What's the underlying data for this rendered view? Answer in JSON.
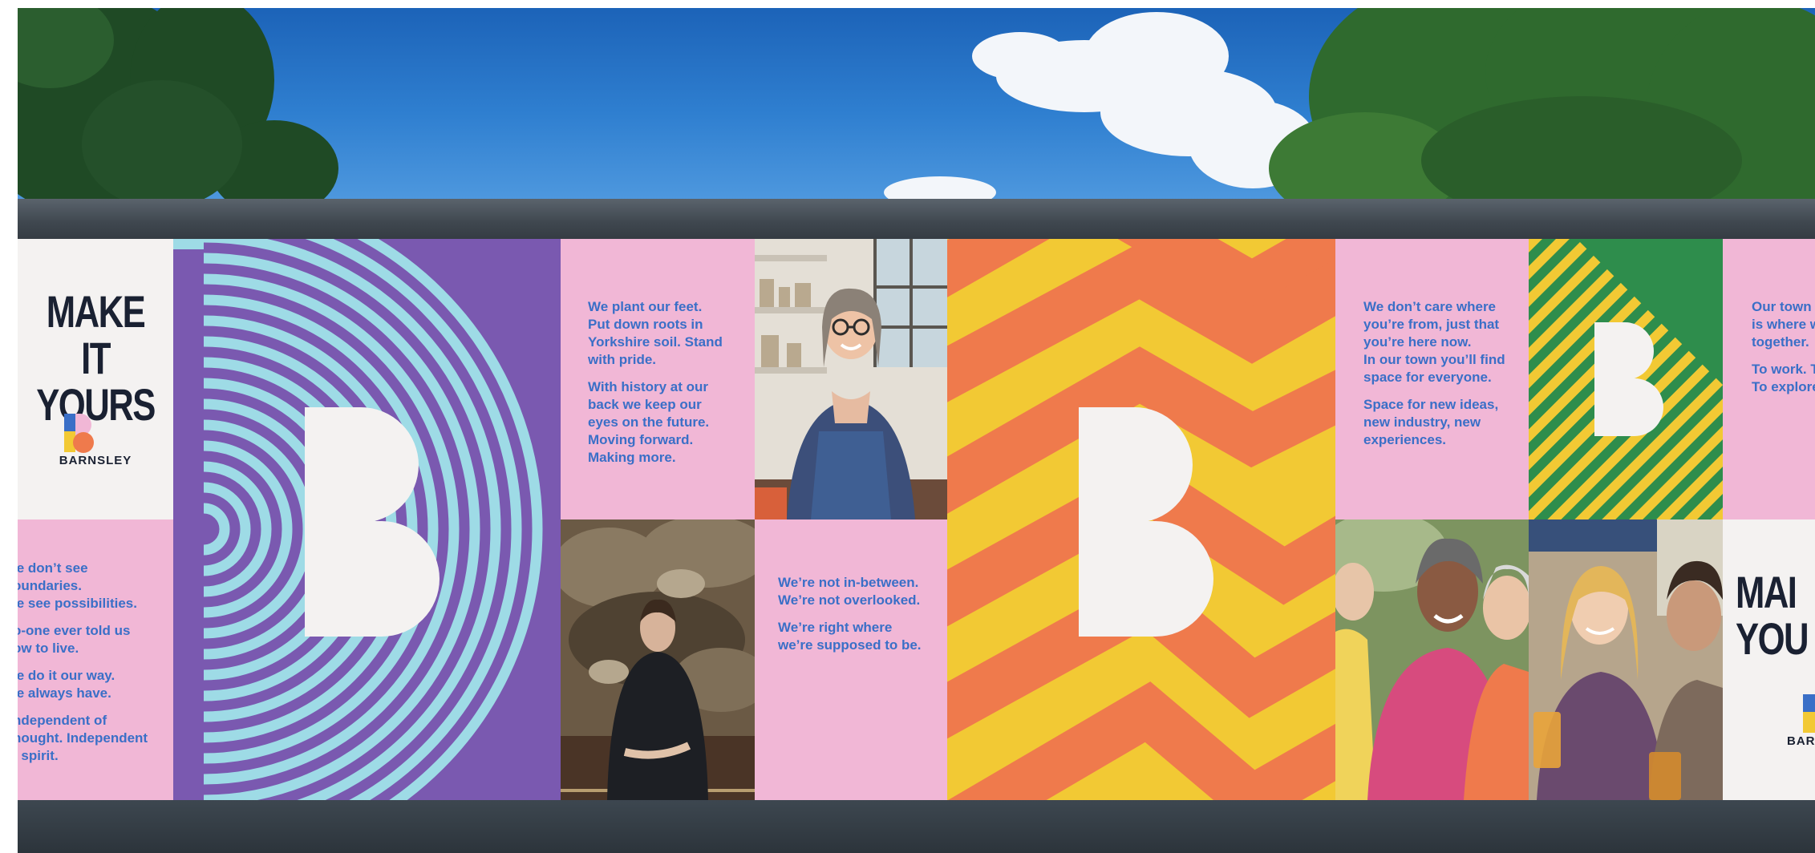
{
  "colors": {
    "pink": "#f1b7d6",
    "purple": "#7a59b0",
    "light_blue": "#9edbe6",
    "orange": "#ef7a4c",
    "yellow": "#f2c934",
    "green": "#2e8d4c",
    "copy_blue": "#3a6fc7",
    "navy": "#1a2132",
    "offwhite": "#f4f2f1"
  },
  "panel_make_it_yours_left": {
    "headline": "MAKE IT\nYOURS",
    "brand": "BARNSLEY",
    "logo_icon": "barnsley-b-logo-icon"
  },
  "panel_left_copy": {
    "paragraphs": [
      "/e don’t see\noundaries.\n/e see possibilities.",
      "o-one ever told us\now to live.",
      "/e do it our way.\n/e always have.",
      "ndependent of\nhought. Independent\nf spirit."
    ]
  },
  "panel_roots_copy": {
    "paragraphs": [
      "We plant our feet.\nPut down roots in\nYorkshire soil. Stand\nwith pride.",
      "With history at our\nback we keep our\neyes on the future.\nMoving forward.\nMaking more."
    ]
  },
  "panel_not_inbetween_copy": {
    "paragraphs": [
      "We’re not in-between.\nWe’re not overlooked.",
      "We’re right where\nwe’re supposed to be."
    ]
  },
  "panel_dont_care_copy": {
    "paragraphs": [
      "We don’t care where\nyou’re from, just that\nyou’re here now.\nIn our town you’ll find\nspace for everyone.",
      "Space for new ideas,\nnew industry, new\nexperiences."
    ]
  },
  "panel_our_town_copy": {
    "paragraphs": [
      "Our town c\nis where w\ntogether.",
      "To work. T\nTo explore"
    ]
  },
  "panel_make_it_yours_right": {
    "headline": "MAI\nYOU",
    "brand": "BARN"
  }
}
